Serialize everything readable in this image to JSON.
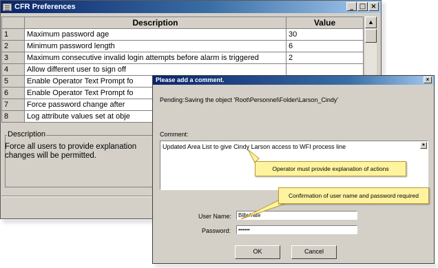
{
  "main_window": {
    "title": "CFR Preferences",
    "buttons": {
      "minimize": "_",
      "maximize": "□",
      "close": "×"
    },
    "table": {
      "headers": [
        "",
        "Description",
        "Value"
      ],
      "rows": [
        {
          "num": "1",
          "desc": "Maximum password age",
          "value": "30"
        },
        {
          "num": "2",
          "desc": "Minimum password length",
          "value": "6"
        },
        {
          "num": "3",
          "desc": "Maximum consecutive invalid login attempts before alarm is triggered",
          "value": "2"
        },
        {
          "num": "4",
          "desc": "Allow different user to sign off",
          "value": ""
        },
        {
          "num": "5",
          "desc": "Enable Operator Text Prompt fo",
          "value": ""
        },
        {
          "num": "6",
          "desc": "Enable Operator Text Prompt fo",
          "value": ""
        },
        {
          "num": "7",
          "desc": "Force password change after",
          "value": ""
        },
        {
          "num": "8",
          "desc": "Log attribute values set at obje",
          "value": ""
        }
      ]
    },
    "description": {
      "legend": "Description",
      "text_line1": "Force all users to provide explanation",
      "text_line2": "changes will be permitted."
    }
  },
  "dialog": {
    "title": "Please add a comment.",
    "pending_label": "Pending:",
    "pending_value": "Saving the object 'Root\\Personnel\\Folder\\Larson_Cindy'",
    "comment_label": "Comment:",
    "comment_value": "Updated Area List to give Cindy Larson access to WFI process line",
    "username_label": "User Name:",
    "username_value": "BillwYate",
    "password_label": "Password:",
    "password_value": "••••••",
    "ok_label": "OK",
    "cancel_label": "Cancel",
    "close": "×"
  },
  "callouts": {
    "explanation": "Operator must provide explanation of actions",
    "confirmation": "Confirmation of user name and password required"
  },
  "colors": {
    "titlebar_start": "#0a246a",
    "window_face": "#d4d0c8",
    "callout_bg": "#fff3a0"
  }
}
